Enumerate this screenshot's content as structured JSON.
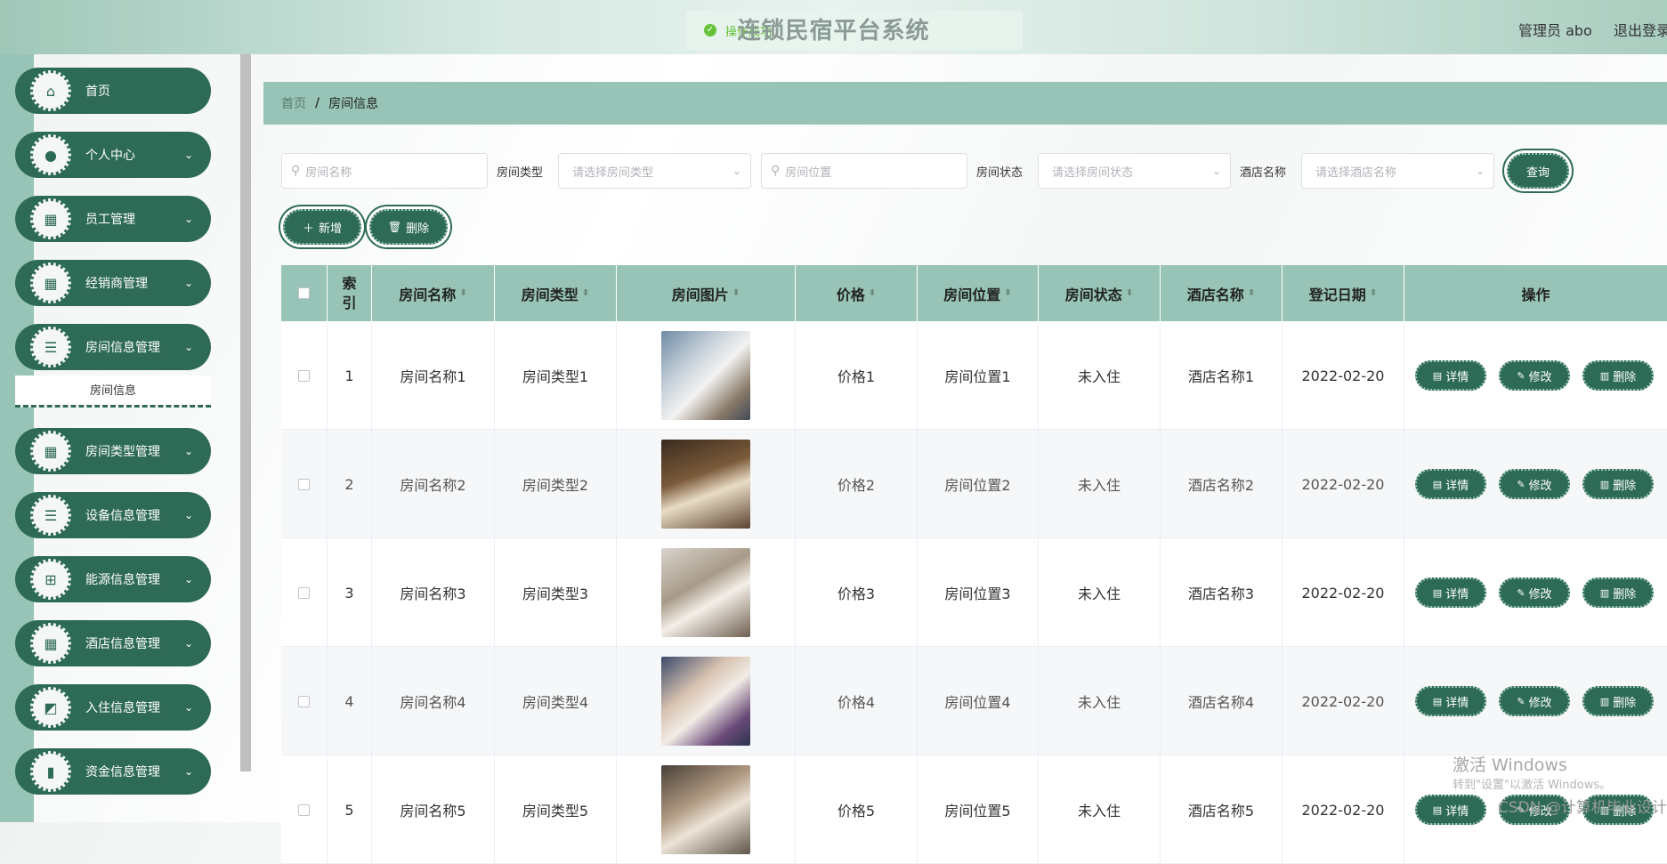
{
  "header": {
    "title": "连锁民宿平台系统",
    "toast_text": "操作成功",
    "admin_label": "管理员 abo",
    "logout_label": "退出登录"
  },
  "sidebar": {
    "items": [
      {
        "label": "首页",
        "icon": "home-icon"
      },
      {
        "label": "个人中心",
        "icon": "user-icon"
      },
      {
        "label": "员工管理",
        "icon": "grid-icon"
      },
      {
        "label": "经销商管理",
        "icon": "grid-icon"
      },
      {
        "label": "房间信息管理",
        "icon": "list-icon"
      },
      {
        "label": "房间类型管理",
        "icon": "grid-icon"
      },
      {
        "label": "设备信息管理",
        "icon": "list-icon"
      },
      {
        "label": "能源信息管理",
        "icon": "apps-icon"
      },
      {
        "label": "酒店信息管理",
        "icon": "grid-icon"
      },
      {
        "label": "入住信息管理",
        "icon": "chart-icon"
      },
      {
        "label": "资金信息管理",
        "icon": "bar-chart-icon"
      }
    ],
    "submenu_active": "房间信息"
  },
  "breadcrumb": {
    "home": "首页",
    "separator": "/",
    "current": "房间信息"
  },
  "filters": {
    "room_name_placeholder": "房间名称",
    "room_type_label": "房间类型",
    "room_type_placeholder": "请选择房间类型",
    "room_location_placeholder": "房间位置",
    "room_status_label": "房间状态",
    "room_status_placeholder": "请选择房间状态",
    "hotel_name_label": "酒店名称",
    "hotel_name_placeholder": "请选择酒店名称",
    "search_label": "查询"
  },
  "actions": {
    "add_label": "新增",
    "delete_label": "删除"
  },
  "table": {
    "headers": {
      "index": "索引",
      "room_name": "房间名称",
      "room_type": "房间类型",
      "room_image": "房间图片",
      "price": "价格",
      "location": "房间位置",
      "status": "房间状态",
      "hotel": "酒店名称",
      "date": "登记日期",
      "ops": "操作"
    },
    "row_buttons": {
      "detail": "详情",
      "edit": "修改",
      "delete": "删除"
    },
    "rows": [
      {
        "index": "1",
        "room_name": "房间名称1",
        "room_type": "房间类型1",
        "price": "价格1",
        "location": "房间位置1",
        "status": "未入住",
        "hotel": "酒店名称1",
        "date": "2022-02-20"
      },
      {
        "index": "2",
        "room_name": "房间名称2",
        "room_type": "房间类型2",
        "price": "价格2",
        "location": "房间位置2",
        "status": "未入住",
        "hotel": "酒店名称2",
        "date": "2022-02-20"
      },
      {
        "index": "3",
        "room_name": "房间名称3",
        "room_type": "房间类型3",
        "price": "价格3",
        "location": "房间位置3",
        "status": "未入住",
        "hotel": "酒店名称3",
        "date": "2022-02-20"
      },
      {
        "index": "4",
        "room_name": "房间名称4",
        "room_type": "房间类型4",
        "price": "价格4",
        "location": "房间位置4",
        "status": "未入住",
        "hotel": "酒店名称4",
        "date": "2022-02-20"
      },
      {
        "index": "5",
        "room_name": "房间名称5",
        "room_type": "房间类型5",
        "price": "价格5",
        "location": "房间位置5",
        "status": "未入住",
        "hotel": "酒店名称5",
        "date": "2022-02-20"
      }
    ]
  },
  "watermark": {
    "line1": "激活 Windows",
    "line2": "转到\"设置\"以激活 Windows。",
    "csdn": "CSDN @计算机毕业设计"
  },
  "colors": {
    "primary": "#2e6b56",
    "accent_light": "#97c4b6"
  }
}
